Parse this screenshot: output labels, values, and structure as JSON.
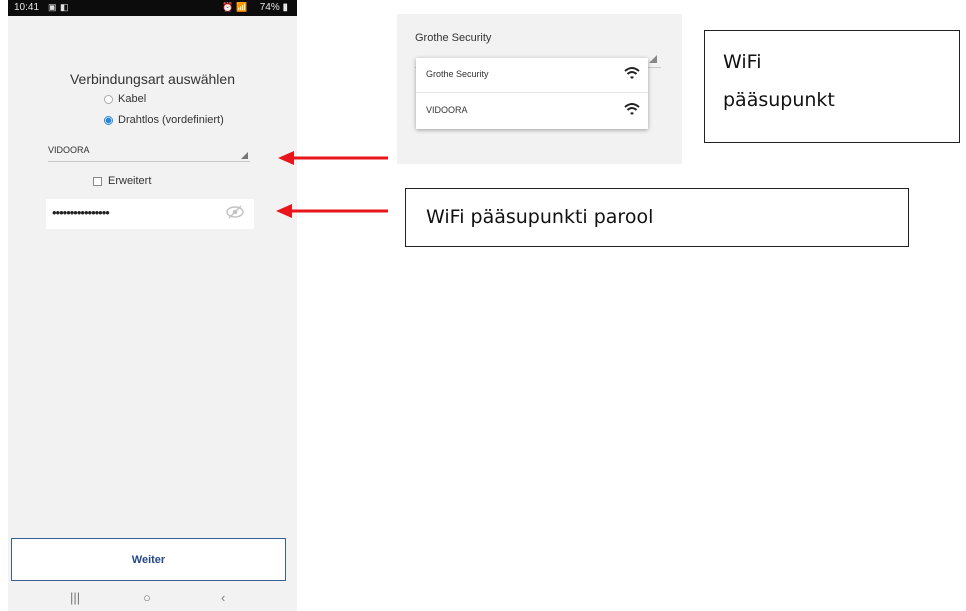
{
  "phone": {
    "status_bar": {
      "time": "10:41",
      "left_icons": [
        "image-icon",
        "app-icon"
      ],
      "battery": "74%"
    },
    "title": "Verbindungsart auswählen",
    "connection_options": [
      {
        "label": "Kabel",
        "selected": false
      },
      {
        "label": "Drahtlos (vordefiniert)",
        "selected": true
      }
    ],
    "network_select": {
      "value": "VIDOORA"
    },
    "advanced_checkbox": {
      "label": "Erweitert",
      "checked": false
    },
    "password_field": {
      "value": "••••••••••••••••"
    },
    "next_button": {
      "label": "Weiter"
    },
    "nav_bar": {
      "recents": "|||",
      "home": "○",
      "back": "‹"
    }
  },
  "dropdown_crop": {
    "select_value": "Grothe Security",
    "options": [
      {
        "label": "Grothe Security",
        "icon": "wifi-icon"
      },
      {
        "label": "VIDOORA",
        "icon": "wifi-icon"
      }
    ]
  },
  "callouts": {
    "access_point_line1": "WiFi",
    "access_point_line2": "pääsupunkt",
    "password": "WiFi pääsupunkti parool"
  },
  "colors": {
    "accent": "#2a86d6",
    "arrow": "#e8161b",
    "button_border": "#3a5f99"
  }
}
